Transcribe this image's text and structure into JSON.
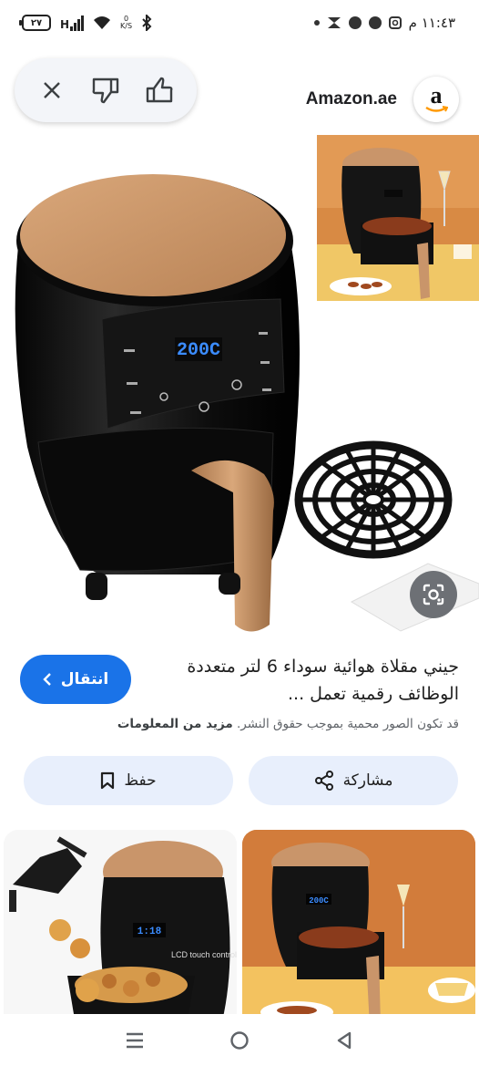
{
  "status_bar": {
    "time": "١١:٤٣ م",
    "battery": "٢٧",
    "network": "H",
    "speed_unit": "K/S"
  },
  "source": {
    "name": "Amazon.ae",
    "logo_letter": "a"
  },
  "product": {
    "title": "جيني مقلاة هوائية سوداء 6 لتر متعددة الوظائف رقمية تعمل ...",
    "display_reading": "200C",
    "visit_label": "انتقال",
    "copyright_text": "قد تكون الصور محمية بموجب حقوق النشر.",
    "more_info": "مزيد من المعلومات"
  },
  "actions": {
    "share_label": "مشاركة",
    "save_label": "حفظ"
  },
  "related": {
    "left_display": "1:18",
    "left_caption": "LCD touch control",
    "right_display": "200C"
  },
  "colors": {
    "accent": "#1a73e8",
    "button_bg": "#e8effc",
    "fryer_lid": "#c9956a",
    "fryer_body": "#141414",
    "display": "#3b8cff"
  },
  "icons": [
    "battery-icon",
    "signal-icon",
    "wifi-icon",
    "bluetooth-icon",
    "dot-icon",
    "inbox-icon",
    "facebook-icon",
    "messenger-icon",
    "instagram-icon",
    "close-icon",
    "thumbs-down-icon",
    "thumbs-up-icon",
    "lens-icon",
    "chevron-left-icon",
    "share-icon",
    "bookmark-icon",
    "menu-icon",
    "home-icon",
    "back-icon"
  ]
}
